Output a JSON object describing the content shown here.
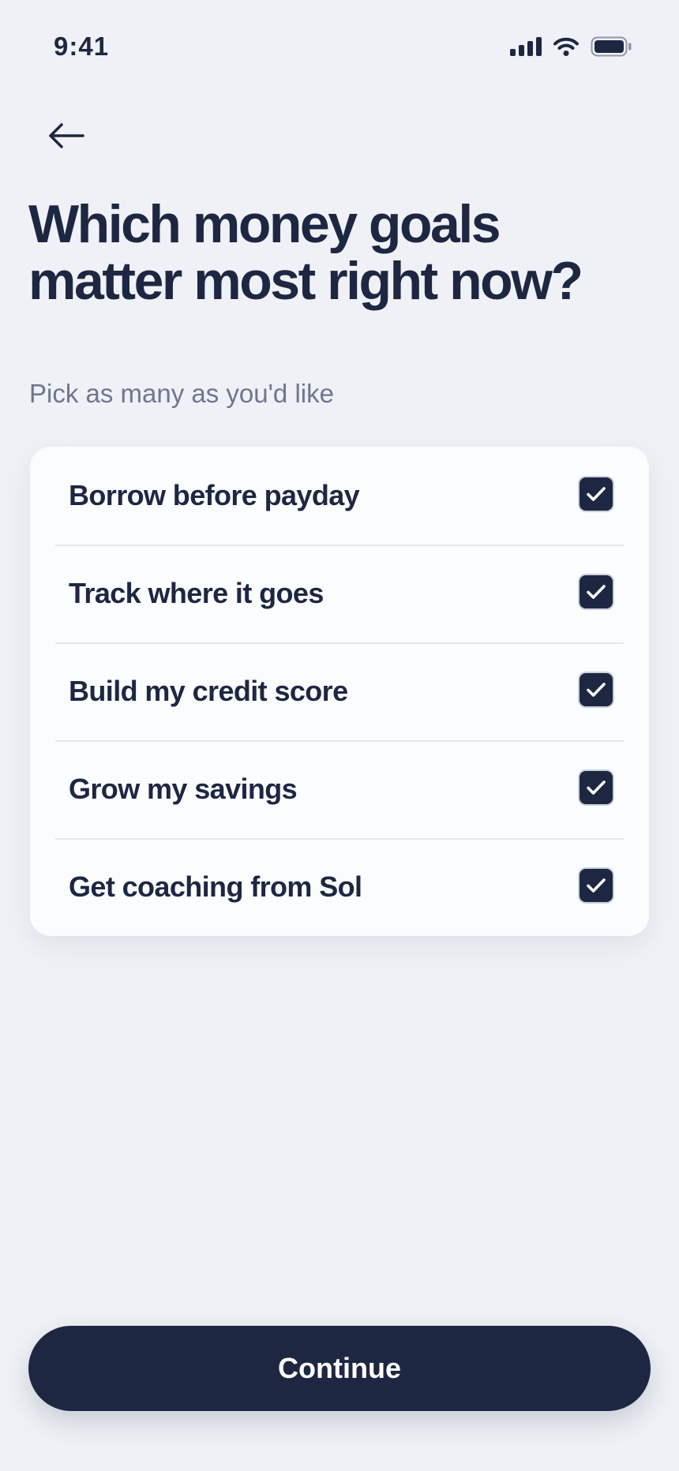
{
  "status_bar": {
    "time": "9:41",
    "icons": [
      "cellular-signal-icon",
      "wifi-icon",
      "battery-icon"
    ]
  },
  "header": {
    "back_icon": "arrow-left-icon",
    "title": "Which money goals matter most right now?",
    "subtitle": "Pick as many as you'd like"
  },
  "goals": [
    {
      "label": "Borrow before payday",
      "checked": true
    },
    {
      "label": "Track where it goes",
      "checked": true
    },
    {
      "label": "Build my credit score",
      "checked": true
    },
    {
      "label": "Grow my savings",
      "checked": true
    },
    {
      "label": "Get coaching from Sol",
      "checked": true
    }
  ],
  "continue_label": "Continue",
  "colors": {
    "background": "#EFF1F6",
    "primary": "#1E2742",
    "card": "#FAFCFE",
    "subtitle": "#6E7690",
    "divider": "#E3E7EE"
  }
}
